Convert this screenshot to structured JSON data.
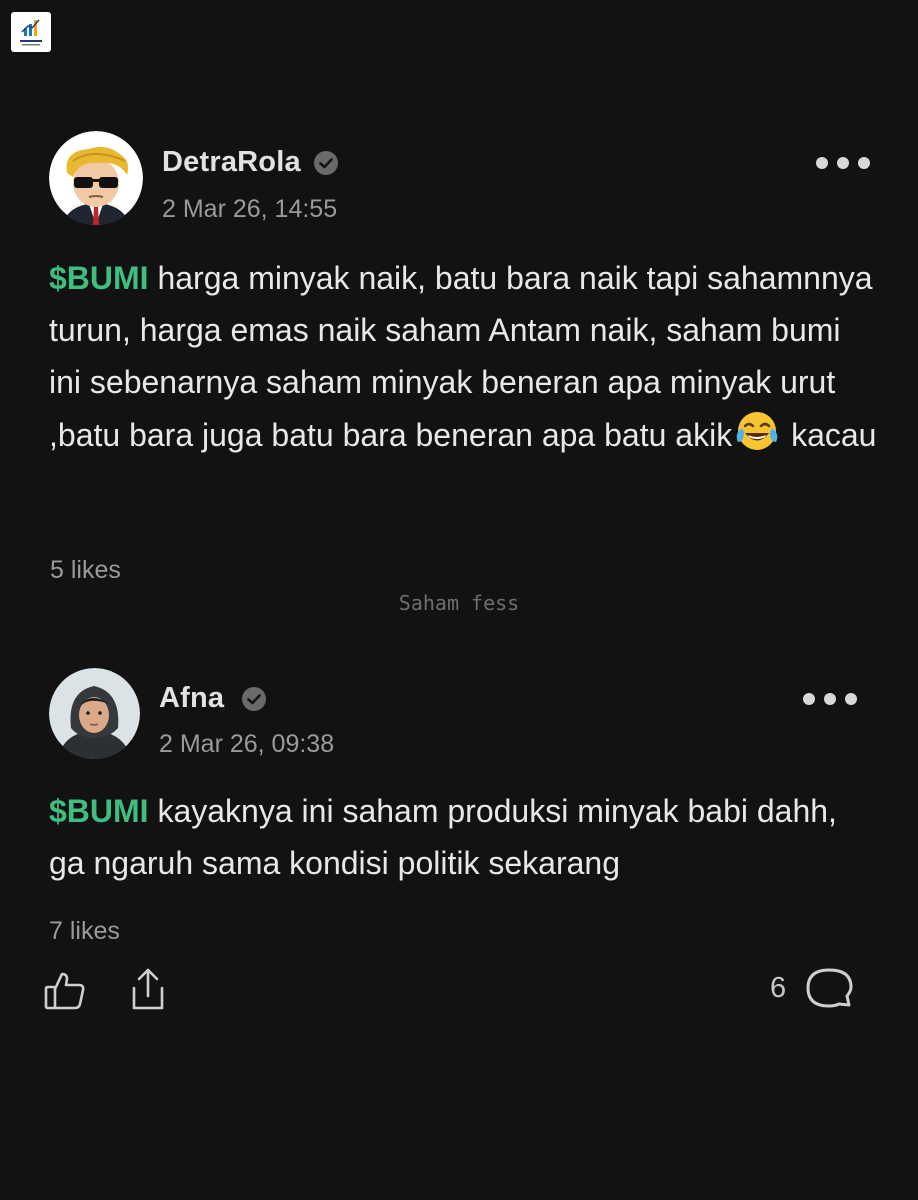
{
  "watermark_text": "Saham fess",
  "posts": [
    {
      "username": "DetraRola",
      "timestamp": "2 Mar 26, 14:55",
      "ticker": "$BUMI",
      "body_before_emoji": " harga minyak naik, batu bara naik tapi sahamnnya turun, harga emas naik saham Antam naik, saham bumi ini sebenarnya saham minyak beneran apa minyak urut ,batu bara juga batu bara beneran apa batu akik",
      "body_after_emoji": " kacau",
      "emoji": "face-with-tears-of-joy-icon",
      "likes": "5 likes",
      "verified": true
    },
    {
      "username": "Afna",
      "timestamp": "2 Mar 26, 09:38",
      "ticker": "$BUMI",
      "body": " kayaknya ini saham produksi minyak babi dahh, ga ngaruh sama kondisi politik sekarang",
      "likes": "7 likes",
      "verified": true
    }
  ],
  "actions": {
    "reply_count": "6",
    "icons": [
      "thumbs-up-icon",
      "share-icon",
      "comment-icon"
    ]
  },
  "colors": {
    "background": "#121212",
    "ticker": "#3fbf7f",
    "muted_text": "#9a9a9a"
  }
}
